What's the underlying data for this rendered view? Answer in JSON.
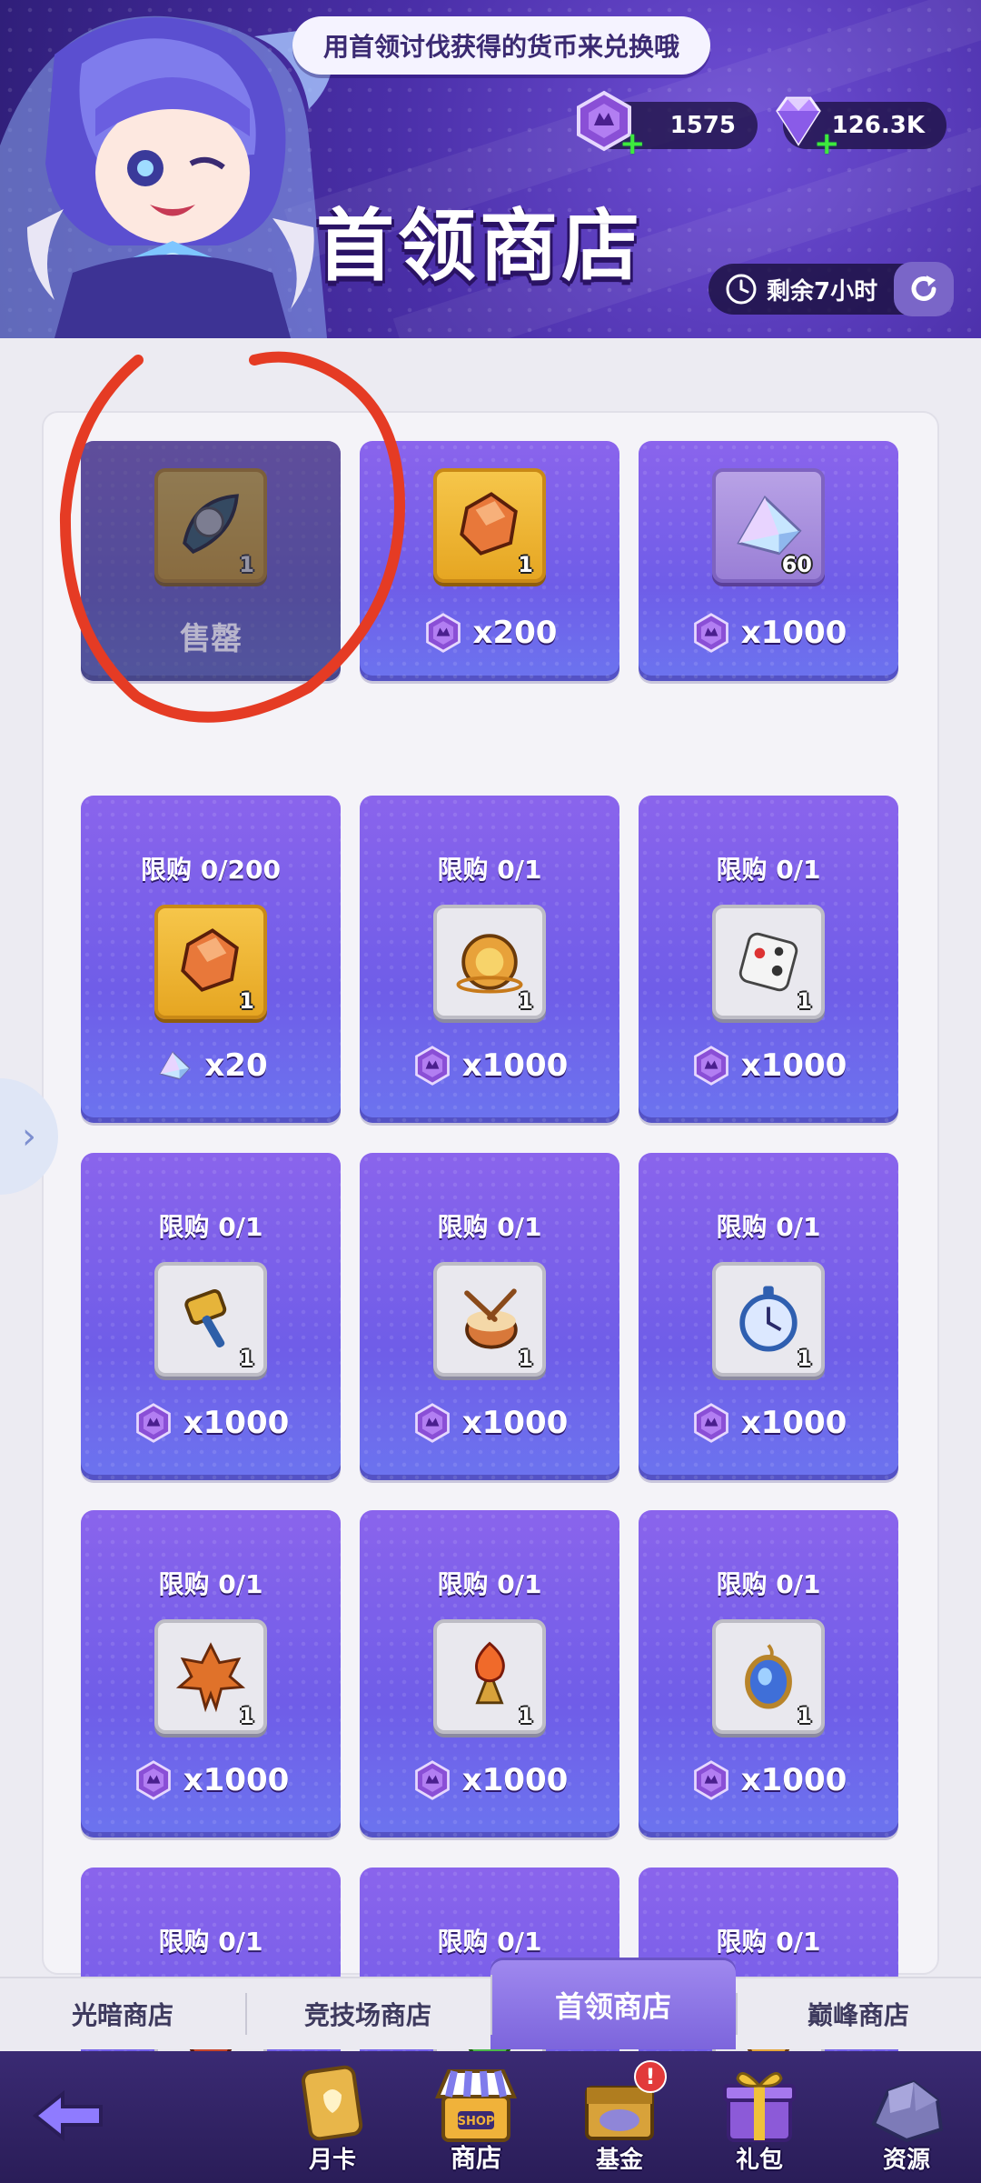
{
  "header": {
    "tip": "用首领讨伐获得的货币来兑换哦",
    "title": "首领商店",
    "currencies": [
      {
        "icon": "boss-token-icon",
        "amount": "1575"
      },
      {
        "icon": "diamond-icon",
        "amount": "126.3K"
      }
    ],
    "timer": "剩余7小时"
  },
  "shop_items": [
    {
      "limit": "",
      "item_icon": "feather-stone-icon",
      "qty": "1",
      "price": "",
      "currency_icon": "",
      "sold_out": true,
      "sold_label": "售罄"
    },
    {
      "limit": "",
      "item_icon": "orange-gem-icon",
      "qty": "1",
      "price": "x200",
      "currency_icon": "boss-token-icon",
      "sold_out": false
    },
    {
      "limit": "",
      "item_icon": "crystal-shard-icon",
      "qty": "60",
      "price": "x1000",
      "currency_icon": "boss-token-icon",
      "sold_out": false
    },
    {
      "limit": "限购 0/200",
      "item_icon": "orange-gem-icon",
      "qty": "1",
      "price": "x20",
      "currency_icon": "crystal-shard-icon",
      "sold_out": false
    },
    {
      "limit": "限购 0/1",
      "item_icon": "golden-bell-icon",
      "qty": "1",
      "price": "x1000",
      "currency_icon": "boss-token-icon",
      "sold_out": false
    },
    {
      "limit": "限购 0/1",
      "item_icon": "dice-icon",
      "qty": "1",
      "price": "x1000",
      "currency_icon": "boss-token-icon",
      "sold_out": false
    },
    {
      "limit": "限购 0/1",
      "item_icon": "golden-hammer-icon",
      "qty": "1",
      "price": "x1000",
      "currency_icon": "boss-token-icon",
      "sold_out": false
    },
    {
      "limit": "限购 0/1",
      "item_icon": "drum-icon",
      "qty": "1",
      "price": "x1000",
      "currency_icon": "boss-token-icon",
      "sold_out": false
    },
    {
      "limit": "限购 0/1",
      "item_icon": "pocket-watch-icon",
      "qty": "1",
      "price": "x1000",
      "currency_icon": "boss-token-icon",
      "sold_out": false
    },
    {
      "limit": "限购 0/1",
      "item_icon": "maple-leaf-icon",
      "qty": "1",
      "price": "x1000",
      "currency_icon": "boss-token-icon",
      "sold_out": false
    },
    {
      "limit": "限购 0/1",
      "item_icon": "fire-torch-icon",
      "qty": "1",
      "price": "x1000",
      "currency_icon": "boss-token-icon",
      "sold_out": false
    },
    {
      "limit": "限购 0/1",
      "item_icon": "blue-amulet-icon",
      "qty": "1",
      "price": "x1000",
      "currency_icon": "boss-token-icon",
      "sold_out": false
    },
    {
      "limit": "限购 0/1",
      "item_icon": "red-pendant-icon",
      "qty": "",
      "price": "",
      "currency_icon": "",
      "sold_out": false
    },
    {
      "limit": "限购 0/1",
      "item_icon": "green-pendant-icon",
      "qty": "",
      "price": "",
      "currency_icon": "",
      "sold_out": false
    },
    {
      "limit": "限购 0/1",
      "item_icon": "gold-pendant-icon",
      "qty": "",
      "price": "",
      "currency_icon": "",
      "sold_out": false
    }
  ],
  "tabs": [
    {
      "label": "光暗商店",
      "active": false
    },
    {
      "label": "竞技场商店",
      "active": false
    },
    {
      "label": "首领商店",
      "active": true
    },
    {
      "label": "巅峰商店",
      "active": false
    }
  ],
  "nav": [
    {
      "label": "月卡",
      "icon": "monthly-card-icon"
    },
    {
      "label": "商店",
      "icon": "shop-stall-icon",
      "active": true,
      "icon_text": "SHOP"
    },
    {
      "label": "基金",
      "icon": "fund-chest-icon",
      "badge": "!"
    },
    {
      "label": "礼包",
      "icon": "gift-box-icon"
    },
    {
      "label": "资源",
      "icon": "resource-ore-icon"
    }
  ],
  "colors": {
    "accent": "#7c65dc",
    "annotation": "#e53b24",
    "card_top": "#8a64ec",
    "card_bottom": "#6c74ef"
  }
}
